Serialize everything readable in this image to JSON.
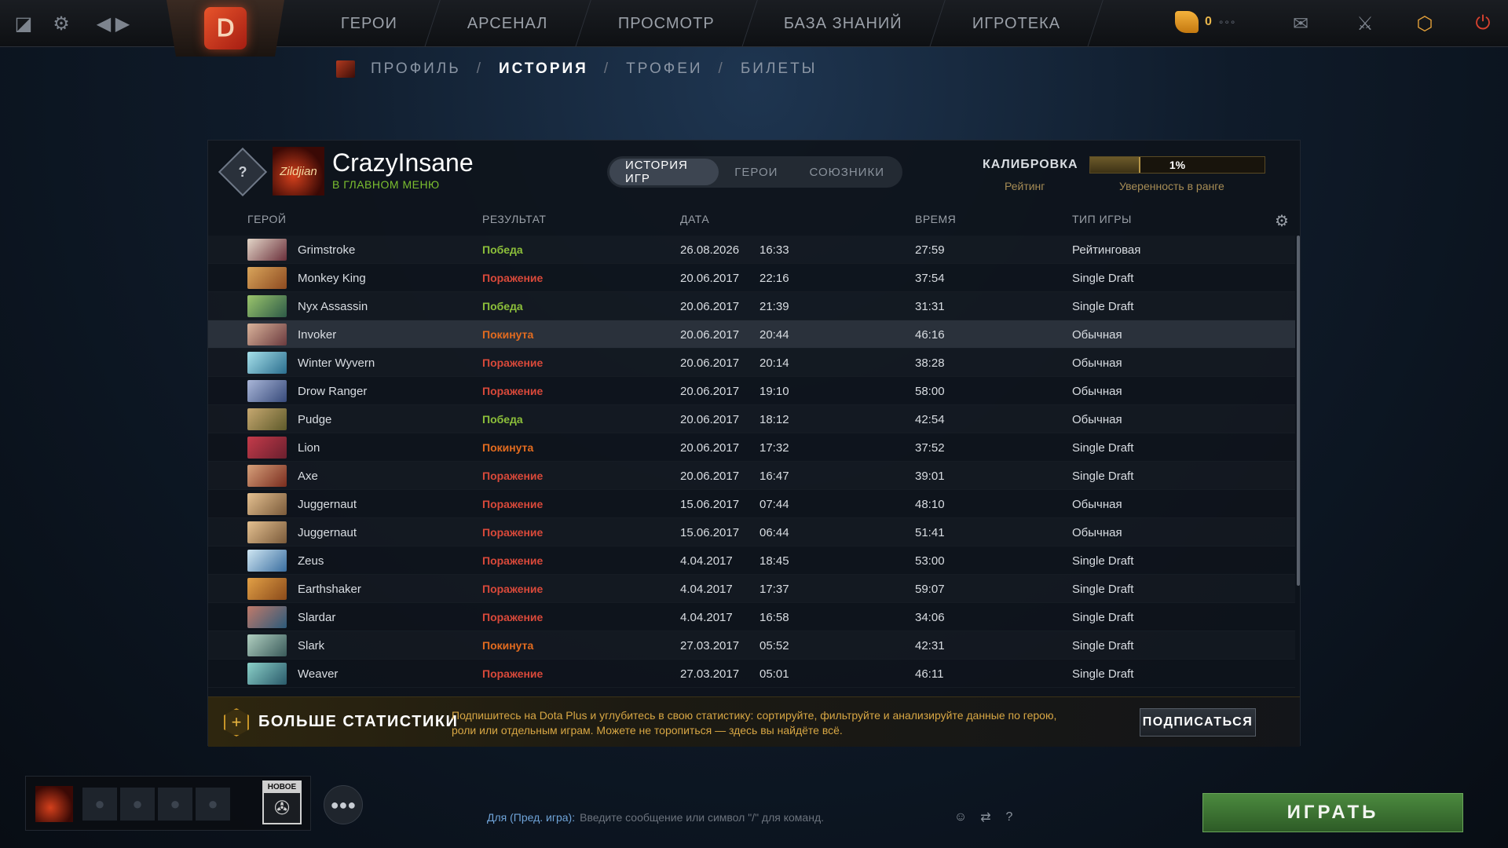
{
  "topnav": {
    "items": [
      "ГЕРОИ",
      "АРСЕНАЛ",
      "ПРОСМОТР",
      "БАЗА ЗНАНИЙ",
      "ИГРОТЕКА"
    ],
    "shards": "0"
  },
  "subnav": {
    "profile": "ПРОФИЛЬ",
    "history": "ИСТОРИЯ",
    "trophies": "ТРОФЕИ",
    "tickets": "БИЛЕТЫ",
    "sep": "/"
  },
  "player": {
    "name": "CrazyInsane",
    "status": "В ГЛАВНОМ МЕНЮ",
    "rank_symbol": "?",
    "avatar_text": "Zildjian"
  },
  "tabs": [
    "ИСТОРИЯ ИГР",
    "ГЕРОИ",
    "СОЮЗНИКИ"
  ],
  "calibration": {
    "title": "КАЛИБРОВКА",
    "rating_label": "Рейтинг",
    "confidence_label": "Уверенность в ранге",
    "confidence_text": "1%",
    "confidence_value": 0.29
  },
  "table": {
    "headers": [
      "ГЕРОЙ",
      "РЕЗУЛЬТАТ",
      "ДАТА",
      "ВРЕМЯ",
      "ТИП ИГРЫ"
    ],
    "rows": [
      {
        "hero": "Grimstroke",
        "result": "Победа",
        "rtype": "win",
        "date": "26.08.2026",
        "clock": "16:33",
        "duration": "27:59",
        "mode": "Рейтинговая",
        "c1": "#6a2f3a",
        "c2": "#e3d6c8"
      },
      {
        "hero": "Monkey King",
        "result": "Поражение",
        "rtype": "loss",
        "date": "20.06.2017",
        "clock": "22:16",
        "duration": "37:54",
        "mode": "Single Draft",
        "c1": "#8d4a20",
        "c2": "#d9a55b"
      },
      {
        "hero": "Nyx Assassin",
        "result": "Победа",
        "rtype": "win",
        "date": "20.06.2017",
        "clock": "21:39",
        "duration": "31:31",
        "mode": "Single Draft",
        "c1": "#2d5a47",
        "c2": "#9bc56c"
      },
      {
        "hero": "Invoker",
        "result": "Покинута",
        "rtype": "aband",
        "date": "20.06.2017",
        "clock": "20:44",
        "duration": "46:16",
        "mode": "Обычная",
        "c1": "#6b3a3e",
        "c2": "#d9b39a"
      },
      {
        "hero": "Winter Wyvern",
        "result": "Поражение",
        "rtype": "loss",
        "date": "20.06.2017",
        "clock": "20:14",
        "duration": "38:28",
        "mode": "Обычная",
        "c1": "#2b6e8e",
        "c2": "#a6e0ea"
      },
      {
        "hero": "Drow Ranger",
        "result": "Поражение",
        "rtype": "loss",
        "date": "20.06.2017",
        "clock": "19:10",
        "duration": "58:00",
        "mode": "Обычная",
        "c1": "#374a7a",
        "c2": "#a9b6d8"
      },
      {
        "hero": "Pudge",
        "result": "Победа",
        "rtype": "win",
        "date": "20.06.2017",
        "clock": "18:12",
        "duration": "42:54",
        "mode": "Обычная",
        "c1": "#5e5a2a",
        "c2": "#c6a870"
      },
      {
        "hero": "Lion",
        "result": "Покинута",
        "rtype": "aband",
        "date": "20.06.2017",
        "clock": "17:32",
        "duration": "37:52",
        "mode": "Single Draft",
        "c1": "#6a1f2e",
        "c2": "#c43b4a"
      },
      {
        "hero": "Axe",
        "result": "Поражение",
        "rtype": "loss",
        "date": "20.06.2017",
        "clock": "16:47",
        "duration": "39:01",
        "mode": "Single Draft",
        "c1": "#7a2c1e",
        "c2": "#d6a07a"
      },
      {
        "hero": "Juggernaut",
        "result": "Поражение",
        "rtype": "loss",
        "date": "15.06.2017",
        "clock": "07:44",
        "duration": "48:10",
        "mode": "Обычная",
        "c1": "#7a5a3a",
        "c2": "#e4c090"
      },
      {
        "hero": "Juggernaut",
        "result": "Поражение",
        "rtype": "loss",
        "date": "15.06.2017",
        "clock": "06:44",
        "duration": "51:41",
        "mode": "Обычная",
        "c1": "#7a5a3a",
        "c2": "#e4c090"
      },
      {
        "hero": "Zeus",
        "result": "Поражение",
        "rtype": "loss",
        "date": "4.04.2017",
        "clock": "18:45",
        "duration": "53:00",
        "mode": "Single Draft",
        "c1": "#3a6ea0",
        "c2": "#cfe6f2"
      },
      {
        "hero": "Earthshaker",
        "result": "Поражение",
        "rtype": "loss",
        "date": "4.04.2017",
        "clock": "17:37",
        "duration": "59:07",
        "mode": "Single Draft",
        "c1": "#8a4a1a",
        "c2": "#e2a046"
      },
      {
        "hero": "Slardar",
        "result": "Поражение",
        "rtype": "loss",
        "date": "4.04.2017",
        "clock": "16:58",
        "duration": "34:06",
        "mode": "Single Draft",
        "c1": "#2c5a7a",
        "c2": "#c07a6a"
      },
      {
        "hero": "Slark",
        "result": "Покинута",
        "rtype": "aband",
        "date": "27.03.2017",
        "clock": "05:52",
        "duration": "42:31",
        "mode": "Single Draft",
        "c1": "#3a5a5a",
        "c2": "#b0cfc0"
      },
      {
        "hero": "Weaver",
        "result": "Поражение",
        "rtype": "loss",
        "date": "27.03.2017",
        "clock": "05:01",
        "duration": "46:11",
        "mode": "Single Draft",
        "c1": "#2a5a6a",
        "c2": "#8ad0c8"
      }
    ]
  },
  "dota_plus": {
    "title": "БОЛЬШЕ СТАТИСТИКИ",
    "text": "Подпишитесь на Dota Plus и углубитесь в свою статистику: сортируйте, фильтруйте и анализируйте данные по герою, роли или отдельным играм. Можете не торопиться — здесь вы найдёте всё.",
    "button": "ПОДПИСАТЬСЯ"
  },
  "bottom": {
    "new_label": "НОВОЕ",
    "chat_channel": "Для (Пред. игра):",
    "chat_placeholder": "Введите сообщение или символ \"/\" для команд.",
    "help": "?",
    "play": "ИГРАТЬ"
  },
  "colors": {
    "win": "#8cbf3a",
    "loss": "#d9493a",
    "abandon": "#e26b1f",
    "play_button": "#4c8a3f",
    "dota_plus_gold": "#d8a744"
  },
  "icons": {
    "top_left": [
      "dashboard-icon",
      "settings-gear-icon",
      "back-arrow-icon",
      "forward-arrow-icon"
    ],
    "top_right": [
      "shards-icon",
      "chat-icon",
      "armory-icon",
      "dota-plus-icon",
      "power-icon"
    ]
  }
}
